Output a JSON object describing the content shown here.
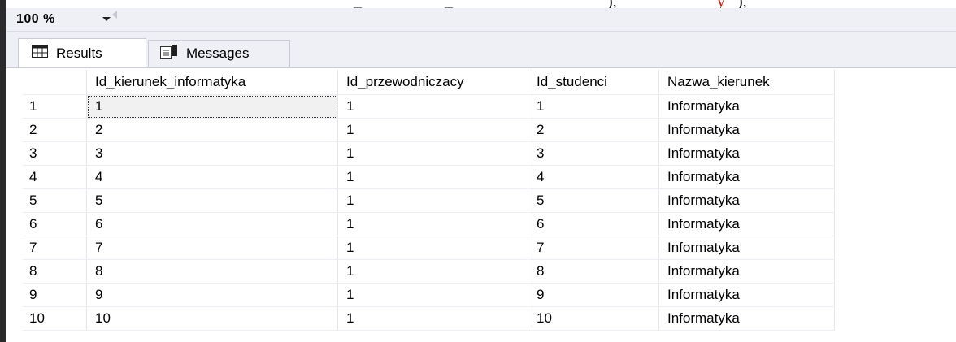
{
  "zoom": {
    "value": "100 %"
  },
  "tabs": [
    {
      "label": "Results",
      "icon": "grid-icon"
    },
    {
      "label": "Messages",
      "icon": "messages-icon"
    }
  ],
  "table": {
    "columns": [
      "Id_kierunek_informatyka",
      "Id_przewodniczacy",
      "Id_studenci",
      "Nazwa_kierunek"
    ],
    "rows": [
      {
        "n": "1",
        "cells": [
          "1",
          "1",
          "1",
          "Informatyka"
        ]
      },
      {
        "n": "2",
        "cells": [
          "2",
          "1",
          "2",
          "Informatyka"
        ]
      },
      {
        "n": "3",
        "cells": [
          "3",
          "1",
          "3",
          "Informatyka"
        ]
      },
      {
        "n": "4",
        "cells": [
          "4",
          "1",
          "4",
          "Informatyka"
        ]
      },
      {
        "n": "5",
        "cells": [
          "5",
          "1",
          "5",
          "Informatyka"
        ]
      },
      {
        "n": "6",
        "cells": [
          "6",
          "1",
          "6",
          "Informatyka"
        ]
      },
      {
        "n": "7",
        "cells": [
          "7",
          "1",
          "7",
          "Informatyka"
        ]
      },
      {
        "n": "8",
        "cells": [
          "8",
          "1",
          "8",
          "Informatyka"
        ]
      },
      {
        "n": "9",
        "cells": [
          "9",
          "1",
          "9",
          "Informatyka"
        ]
      },
      {
        "n": "10",
        "cells": [
          "10",
          "1",
          "10",
          "Informatyka"
        ]
      }
    ]
  },
  "colors": {
    "toolbar_bg": "#eef0f6",
    "selected_cell_bg": "#f1f1f1",
    "editor_gutter": "#2b2b2b"
  }
}
